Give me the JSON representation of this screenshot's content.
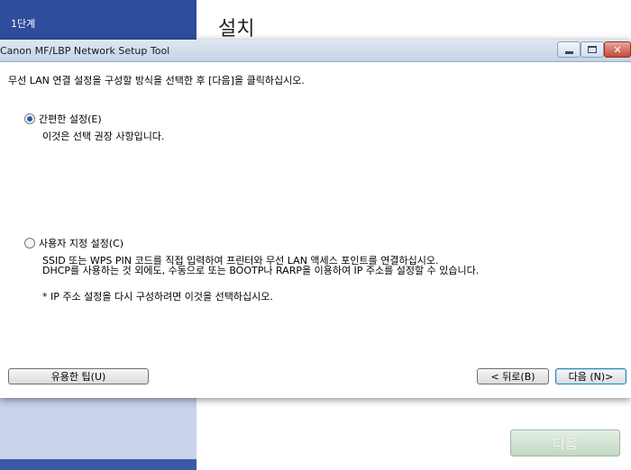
{
  "background": {
    "step_label": "1단계",
    "page_title": "설치",
    "next_label": "다음"
  },
  "dialog": {
    "title": "Canon MF/LBP Network Setup Tool",
    "instruction": "무선 LAN 연결 설정을 구성할 방식을 선택한 후 [다음]을 클릭하십시오.",
    "options": [
      {
        "label": "간편한 설정(E)",
        "checked": true,
        "descriptions": [
          "이것은 선택 권장 사항입니다."
        ]
      },
      {
        "label": "사용자 지정 설정(C)",
        "checked": false,
        "descriptions": [
          "SSID 또는 WPS PIN 코드를 직접 입력하여 프린터와 무선 LAN 액세스 포인트를 연결하십시오.",
          "DHCP를 사용하는 것 외에도, 수동으로 또는 BOOTP나 RARP을 이용하여 IP 주소를 설정할 수 있습니다.",
          "* IP 주소 설정을 다시 구성하려면 이것을 선택하십시오."
        ]
      }
    ],
    "buttons": {
      "tips": "유용한 팁(U)",
      "back": "< 뒤로(B)",
      "next": "다음 (N)>"
    },
    "window_controls": {
      "close": "✕"
    }
  }
}
